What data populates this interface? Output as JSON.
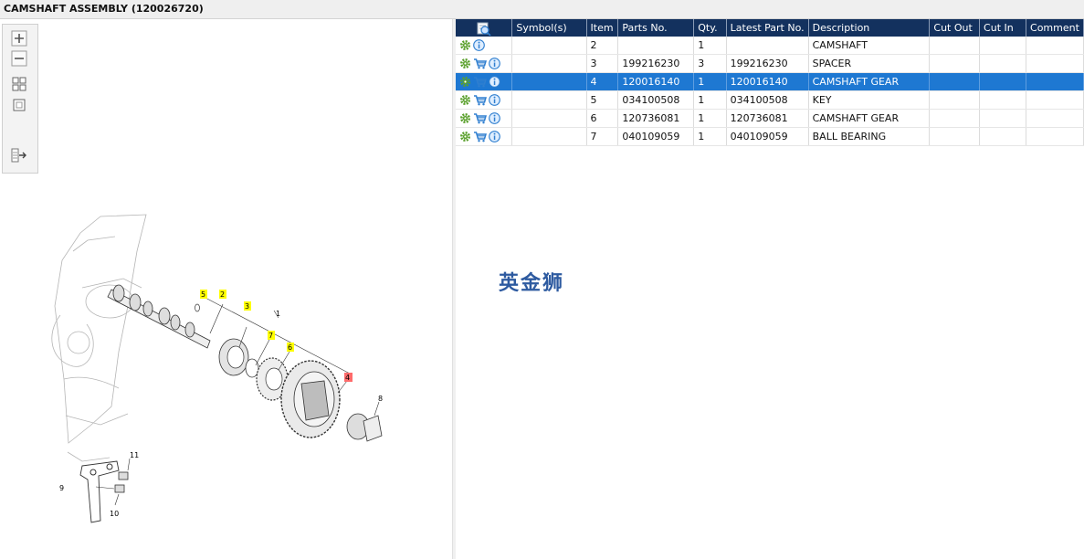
{
  "window": {
    "title": "CAMSHAFT ASSEMBLY (120026720)"
  },
  "toolbar": {
    "buttons": [
      {
        "name": "zoom-in",
        "icon": "zoom-in-icon"
      },
      {
        "name": "zoom-out",
        "icon": "zoom-out-icon"
      },
      {
        "name": "fit-all",
        "icon": "grid-icon"
      },
      {
        "name": "actual-size",
        "icon": "square-icon"
      },
      {
        "name": "export",
        "icon": "export-icon"
      }
    ]
  },
  "diagram": {
    "callouts": [
      "1",
      "2",
      "3",
      "4",
      "5",
      "6",
      "7",
      "8",
      "9",
      "10",
      "11"
    ],
    "highlight_color": "#ffff00",
    "selected_color": "#ff6b6b"
  },
  "table": {
    "headers": [
      "Symbol(s)",
      "Item",
      "Parts No.",
      "Qty.",
      "Latest Part No.",
      "Description",
      "Cut Out",
      "Cut In",
      "Comment"
    ],
    "rows": [
      {
        "cart": false,
        "item": "2",
        "parts_no": "",
        "qty": "1",
        "latest": "",
        "desc": "CAMSHAFT",
        "selected": false
      },
      {
        "cart": true,
        "item": "3",
        "parts_no": "199216230",
        "qty": "3",
        "latest": "199216230",
        "desc": "SPACER",
        "selected": false
      },
      {
        "cart": true,
        "item": "4",
        "parts_no": "120016140",
        "qty": "1",
        "latest": "120016140",
        "desc": "CAMSHAFT GEAR",
        "selected": true
      },
      {
        "cart": true,
        "item": "5",
        "parts_no": "034100508",
        "qty": "1",
        "latest": "034100508",
        "desc": "KEY",
        "selected": false
      },
      {
        "cart": true,
        "item": "6",
        "parts_no": "120736081",
        "qty": "1",
        "latest": "120736081",
        "desc": "CAMSHAFT GEAR",
        "selected": false
      },
      {
        "cart": true,
        "item": "7",
        "parts_no": "040109059",
        "qty": "1",
        "latest": "040109059",
        "desc": "BALL BEARING",
        "selected": false
      }
    ]
  },
  "watermark": "英金狮",
  "colors": {
    "header_bg": "#13315e",
    "selected_row": "#1e78d2",
    "gear_icon": "#5aa02c",
    "info_icon": "#2f7fd0"
  }
}
